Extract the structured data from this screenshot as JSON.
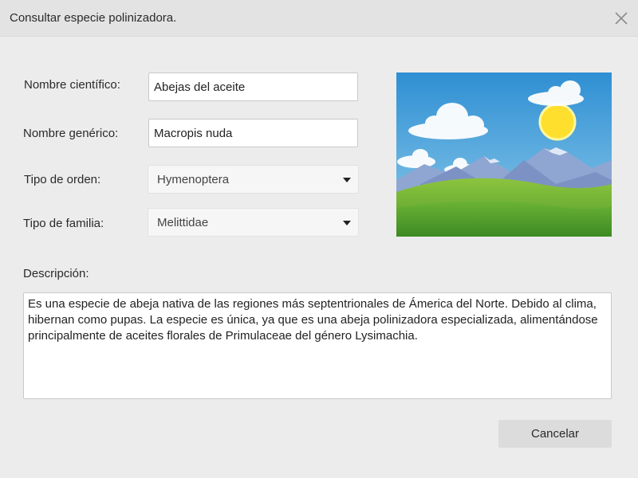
{
  "dialog": {
    "title": "Consultar especie polinizadora."
  },
  "form": {
    "scientific_name": {
      "label": "Nombre científico:",
      "value": "Abejas del aceite"
    },
    "generic_name": {
      "label": "Nombre genérico:",
      "value": "Macropis nuda"
    },
    "order_type": {
      "label": "Tipo de orden:",
      "selected": "Hymenoptera"
    },
    "family_type": {
      "label": "Tipo de familia:",
      "selected": "Melittidae"
    },
    "description": {
      "label": "Descripción:",
      "value": "Es una especie de abeja nativa de las regiones más septentrionales de Ámerica del Norte. Debido al clima, hibernan como pupas. La especie es única, ya que es una abeja polinizadora especializada, alimentándose principalmente de aceites florales de Primulaceae del género Lysimachia."
    }
  },
  "image": {
    "icon": "landscape-image"
  },
  "actions": {
    "cancel_label": "Cancelar"
  },
  "icons": {
    "close": "close-icon",
    "dropdown": "chevron-down-icon"
  },
  "colors": {
    "sky": "#3f9bd6",
    "sun": "#ffe135",
    "grass": "#5aa832",
    "mountain": "#7f96c8"
  }
}
